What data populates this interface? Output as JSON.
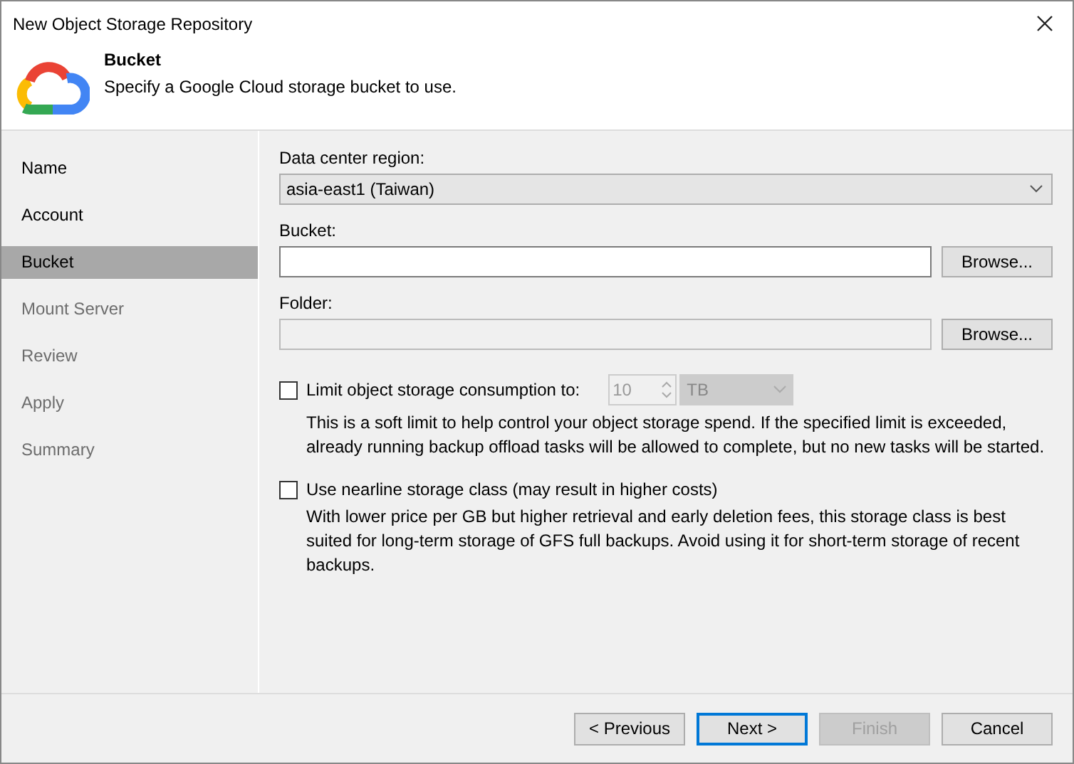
{
  "window": {
    "title": "New Object Storage Repository"
  },
  "header": {
    "title": "Bucket",
    "subtitle": "Specify a Google Cloud storage bucket to use."
  },
  "steps": [
    {
      "label": "Name",
      "selected": false,
      "disabled": false
    },
    {
      "label": "Account",
      "selected": false,
      "disabled": false
    },
    {
      "label": "Bucket",
      "selected": true,
      "disabled": false
    },
    {
      "label": "Mount Server",
      "selected": false,
      "disabled": true
    },
    {
      "label": "Review",
      "selected": false,
      "disabled": true
    },
    {
      "label": "Apply",
      "selected": false,
      "disabled": true
    },
    {
      "label": "Summary",
      "selected": false,
      "disabled": true
    }
  ],
  "region": {
    "label": "Data center region:",
    "value": "asia-east1 (Taiwan)"
  },
  "fields": [
    {
      "label": "Bucket:",
      "disabled": false,
      "button": "Browse..."
    },
    {
      "label": "Folder:",
      "disabled": true,
      "button": "Browse..."
    }
  ],
  "options": [
    {
      "label": "Limit object storage consumption to:",
      "checked": false,
      "description": "This is a soft limit to help control your object storage spend. If the specified limit is exceeded, already running backup offload tasks will be allowed to complete, but no new tasks will be started.",
      "amount": "10",
      "unit": "TB"
    },
    {
      "label": "Use nearline storage class (may result in higher costs)",
      "checked": false,
      "description": "With lower price per GB but higher retrieval and early deletion fees, this storage class is best suited for long-term storage of GFS full backups. Avoid using it for short-term storage of recent backups."
    }
  ],
  "buttons": [
    {
      "label": "< Previous",
      "disabled": false,
      "focused": false
    },
    {
      "label": "Next >",
      "disabled": false,
      "focused": true
    },
    {
      "label": "Finish",
      "disabled": true,
      "focused": false
    },
    {
      "label": "Cancel",
      "disabled": false,
      "focused": false
    }
  ]
}
